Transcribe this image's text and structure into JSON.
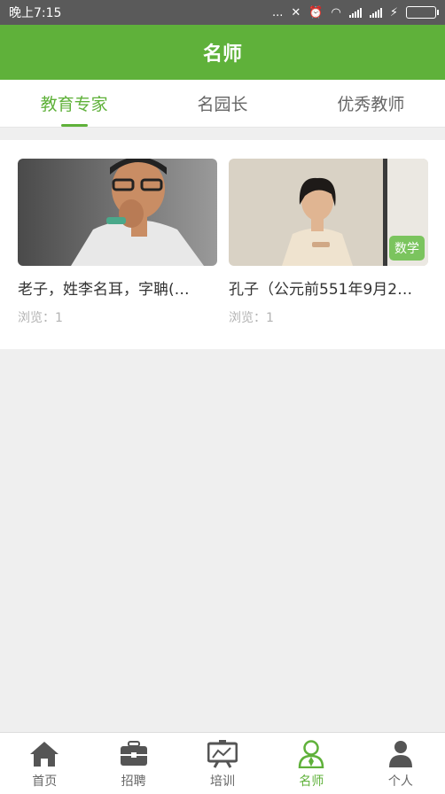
{
  "status": {
    "time": "晚上7:15",
    "dots": "..."
  },
  "header": {
    "title": "名师"
  },
  "tabs": [
    {
      "label": "教育专家",
      "active": true
    },
    {
      "label": "名园长",
      "active": false
    },
    {
      "label": "优秀教师",
      "active": false
    }
  ],
  "cards": [
    {
      "title": "老子，姓李名耳，字聃(…",
      "views": "浏览：1",
      "tag": ""
    },
    {
      "title": "孔子（公元前551年9月2…",
      "views": "浏览：1",
      "tag": "数学"
    }
  ],
  "nav": [
    {
      "label": "首页",
      "icon": "home-icon"
    },
    {
      "label": "招聘",
      "icon": "briefcase-icon"
    },
    {
      "label": "培训",
      "icon": "presentation-board-icon"
    },
    {
      "label": "名师",
      "icon": "teacher-icon",
      "active": true
    },
    {
      "label": "个人",
      "icon": "person-icon"
    }
  ],
  "colors": {
    "accent": "#5fb13a",
    "statusbar": "#5a5a5a"
  }
}
